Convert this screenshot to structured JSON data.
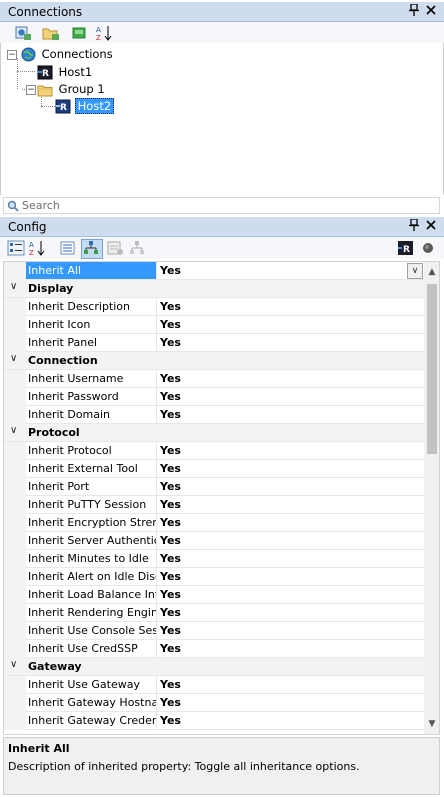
{
  "connections_panel": {
    "title": "Connections",
    "pin_glyph": "⬇",
    "close_glyph": "✕",
    "toolbar": [
      {
        "icon": "new-connection-icon"
      },
      {
        "icon": "new-folder-icon"
      },
      {
        "icon": "view-icon"
      },
      {
        "icon": "sort-az-icon",
        "label": "AZ"
      }
    ],
    "tree": {
      "root": "Connections",
      "host1": "Host1",
      "group1": "Group 1",
      "host2": "Host2",
      "expander_minus": "−"
    },
    "search_placeholder": "Search"
  },
  "config_panel": {
    "title": "Config",
    "pin_glyph": "⬇",
    "close_glyph": "✕",
    "toolbar": [
      {
        "icon": "categorized-icon"
      },
      {
        "icon": "alphabetical-icon"
      },
      {
        "icon": "properties-icon"
      },
      {
        "icon": "inheritance-icon"
      },
      {
        "icon": "default-properties-icon"
      },
      {
        "icon": "default-inheritance-icon"
      }
    ],
    "rows": [
      {
        "type": "prop",
        "name": "Inherit All",
        "value": "Yes",
        "active": true
      },
      {
        "type": "cat",
        "name": "Display"
      },
      {
        "type": "prop",
        "name": "Inherit Description",
        "value": "Yes"
      },
      {
        "type": "prop",
        "name": "Inherit Icon",
        "value": "Yes"
      },
      {
        "type": "prop",
        "name": "Inherit Panel",
        "value": "Yes"
      },
      {
        "type": "cat",
        "name": "Connection"
      },
      {
        "type": "prop",
        "name": "Inherit Username",
        "value": "Yes"
      },
      {
        "type": "prop",
        "name": "Inherit Password",
        "value": "Yes"
      },
      {
        "type": "prop",
        "name": "Inherit Domain",
        "value": "Yes"
      },
      {
        "type": "cat",
        "name": "Protocol"
      },
      {
        "type": "prop",
        "name": "Inherit Protocol",
        "value": "Yes"
      },
      {
        "type": "prop",
        "name": "Inherit External Tool",
        "value": "Yes"
      },
      {
        "type": "prop",
        "name": "Inherit Port",
        "value": "Yes"
      },
      {
        "type": "prop",
        "name": "Inherit PuTTY Session",
        "value": "Yes"
      },
      {
        "type": "prop",
        "name": "Inherit Encryption Strengt",
        "value": "Yes"
      },
      {
        "type": "prop",
        "name": "Inherit Server Authenticat",
        "value": "Yes"
      },
      {
        "type": "prop",
        "name": "Inherit Minutes to Idle",
        "value": "Yes"
      },
      {
        "type": "prop",
        "name": "Inherit Alert on Idle Disco",
        "value": "Yes"
      },
      {
        "type": "prop",
        "name": "Inherit Load Balance Info",
        "value": "Yes"
      },
      {
        "type": "prop",
        "name": "Inherit Rendering Engine",
        "value": "Yes"
      },
      {
        "type": "prop",
        "name": "Inherit Use Console Sessi",
        "value": "Yes"
      },
      {
        "type": "prop",
        "name": "Inherit Use CredSSP",
        "value": "Yes"
      },
      {
        "type": "cat",
        "name": "Gateway"
      },
      {
        "type": "prop",
        "name": "Inherit Use Gateway",
        "value": "Yes"
      },
      {
        "type": "prop",
        "name": "Inherit Gateway Hostnam",
        "value": "Yes"
      },
      {
        "type": "prop",
        "name": "Inherit Gateway Credenti",
        "value": "Yes"
      }
    ],
    "description": {
      "title": "Inherit All",
      "text": "Description of inherited property: Toggle all inheritance options."
    }
  },
  "colors": {
    "header_bg": "#cfdcee",
    "selection": "#3399ff",
    "category_bg": "#f3f3f3"
  }
}
